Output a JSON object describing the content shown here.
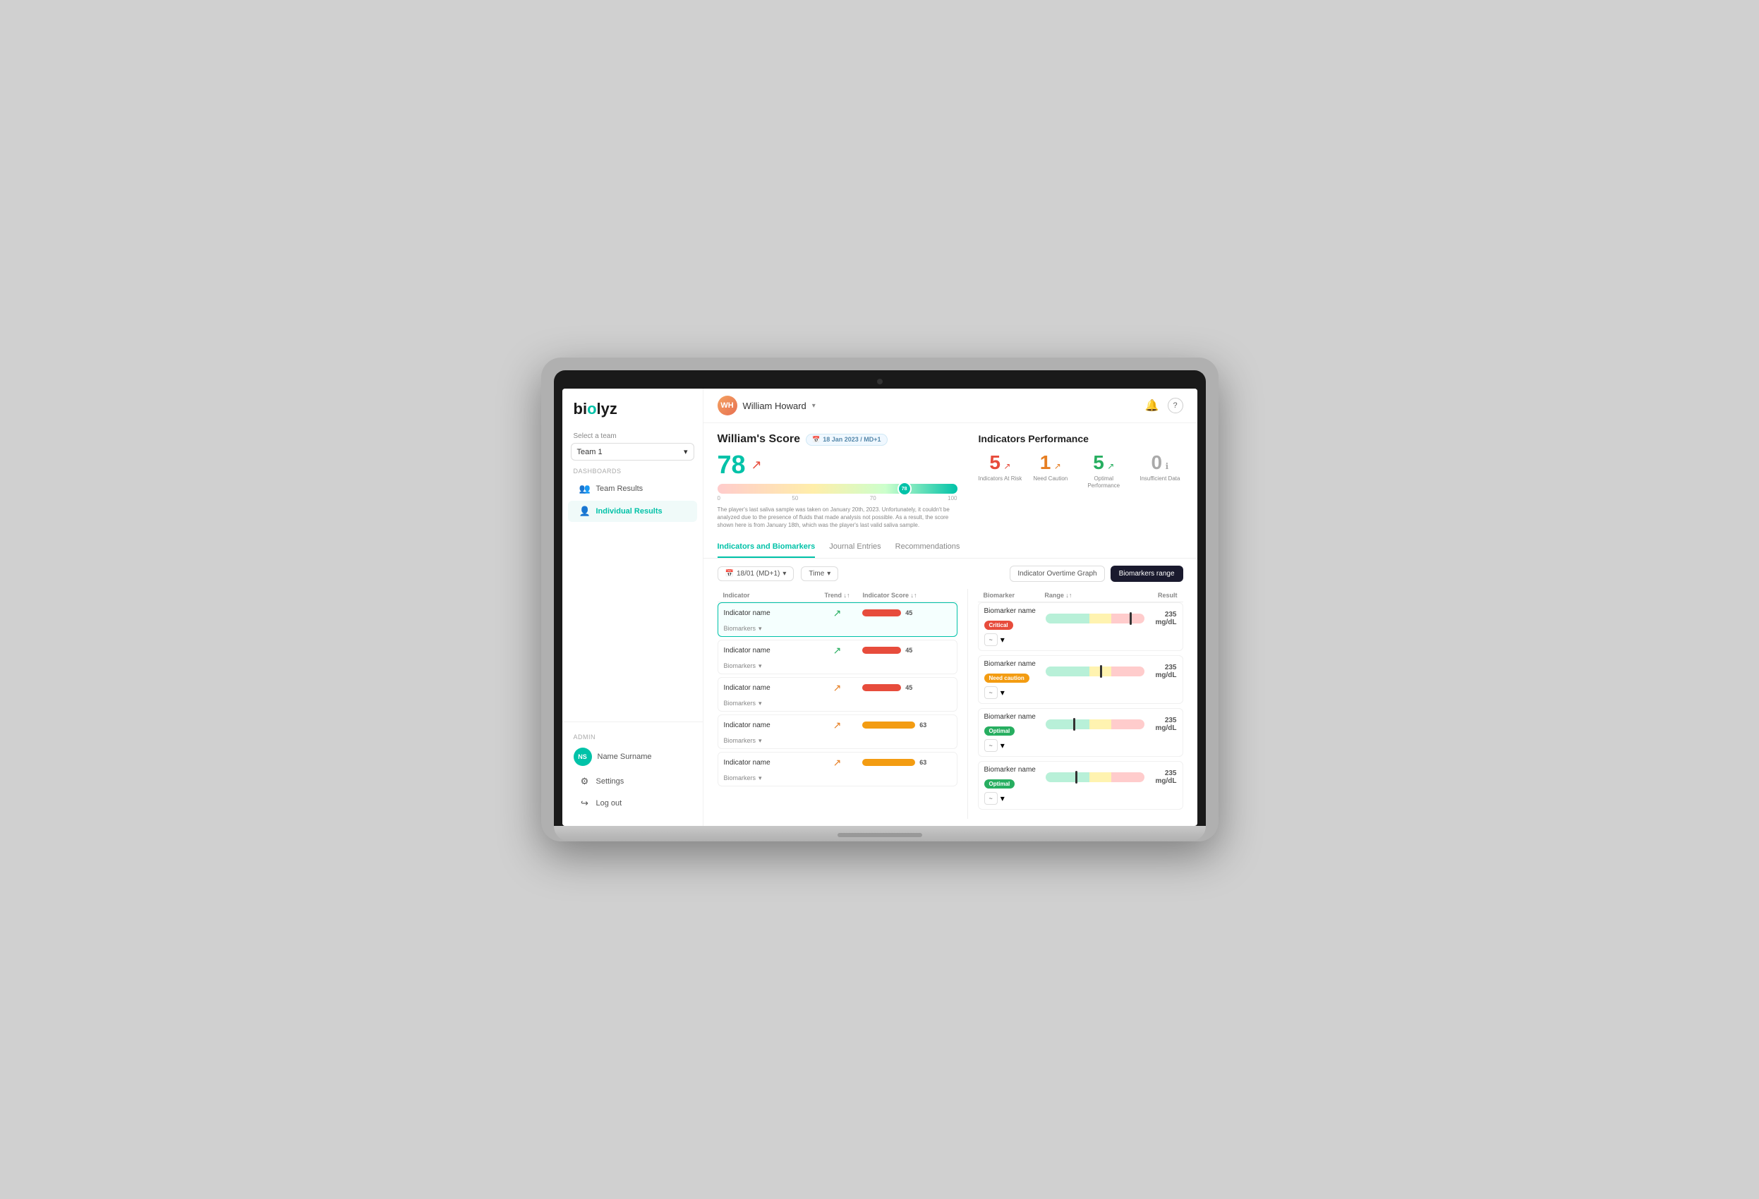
{
  "app": {
    "logo": "biolyz",
    "logo_dot": "o"
  },
  "topbar": {
    "user_name": "William Howard",
    "user_initials": "WH",
    "notification_icon": "🔔",
    "help_icon": "?"
  },
  "sidebar": {
    "select_team_label": "Select a team",
    "team_selected": "Team 1",
    "dashboards_label": "Dashboards",
    "nav_items": [
      {
        "label": "Team Results",
        "icon": "👥",
        "active": false
      },
      {
        "label": "Individual Results",
        "icon": "👤",
        "active": true
      }
    ],
    "admin_label": "Admin",
    "user_initials": "NS",
    "user_name": "Name Surname",
    "settings_label": "Settings",
    "logout_label": "Log out"
  },
  "score": {
    "title": "William's Score",
    "date_badge": "18 Jan 2023 / MD+1",
    "value": "78",
    "bar_positions": [
      "0",
      "50",
      "70",
      "100"
    ],
    "marker_pct": "78",
    "note": "The player's last saliva sample was taken on January 20th, 2023. Unfortunately, it couldn't be analyzed due to the presence of fluids that made analysis not possible. As a result, the score shown here is from January 18th, which was the player's last valid saliva sample."
  },
  "indicators_performance": {
    "title": "Indicators Performance",
    "items": [
      {
        "value": "5",
        "label": "Indicators At Risk",
        "color": "red"
      },
      {
        "value": "1",
        "label": "Need Caution",
        "color": "orange"
      },
      {
        "value": "5",
        "label": "Optimal Performance",
        "color": "green"
      },
      {
        "value": "0",
        "label": "Insufficient Data",
        "color": "gray"
      }
    ]
  },
  "tabs": [
    {
      "label": "Indicators and Biomarkers",
      "active": true
    },
    {
      "label": "Journal Entries",
      "active": false
    },
    {
      "label": "Recommendations",
      "active": false
    }
  ],
  "filters": {
    "date_filter": "18/01 (MD+1)",
    "time_filter": "Time",
    "graph_btn": "Indicator Overtime Graph",
    "range_btn": "Biomarkers range"
  },
  "indicators_table": {
    "headers": [
      "Indicator",
      "Trend ↓↑",
      "Indicator Score ↓↑"
    ],
    "rows": [
      {
        "name": "Indicator name",
        "trend": "↗",
        "trend_color": "green",
        "score": 45,
        "score_color": "red",
        "active": true
      },
      {
        "name": "Indicator name",
        "trend": "↗",
        "trend_color": "green",
        "score": 45,
        "score_color": "red",
        "active": false
      },
      {
        "name": "Indicator name",
        "trend": "↗",
        "trend_color": "orange",
        "score": 45,
        "score_color": "red",
        "active": false
      },
      {
        "name": "Indicator name",
        "trend": "↗",
        "trend_color": "orange",
        "score": 63,
        "score_color": "yellow",
        "active": false
      },
      {
        "name": "Indicator name",
        "trend": "↗",
        "trend_color": "orange",
        "score": 63,
        "score_color": "yellow",
        "active": false
      }
    ],
    "biomarkers_label": "Biomarkers"
  },
  "biomarkers_table": {
    "headers": [
      "Biomarker",
      "Range ↓↑",
      "Result"
    ],
    "rows": [
      {
        "name": "Biomarker name",
        "status": "Critical",
        "status_color": "red",
        "marker_pos": "85",
        "result": "235 mg/dL"
      },
      {
        "name": "Biomarker name",
        "status": "Need caution",
        "status_color": "yellow",
        "marker_pos": "58",
        "result": "235 mg/dL"
      },
      {
        "name": "Biomarker name",
        "status": "Optimal",
        "status_color": "green",
        "marker_pos": "30",
        "result": "235 mg/dL"
      },
      {
        "name": "Biomarker name",
        "status": "Optimal",
        "status_color": "green",
        "marker_pos": "32",
        "result": "235 mg/dL"
      }
    ],
    "chart_btn_label": "~",
    "expand_label": "▾"
  }
}
